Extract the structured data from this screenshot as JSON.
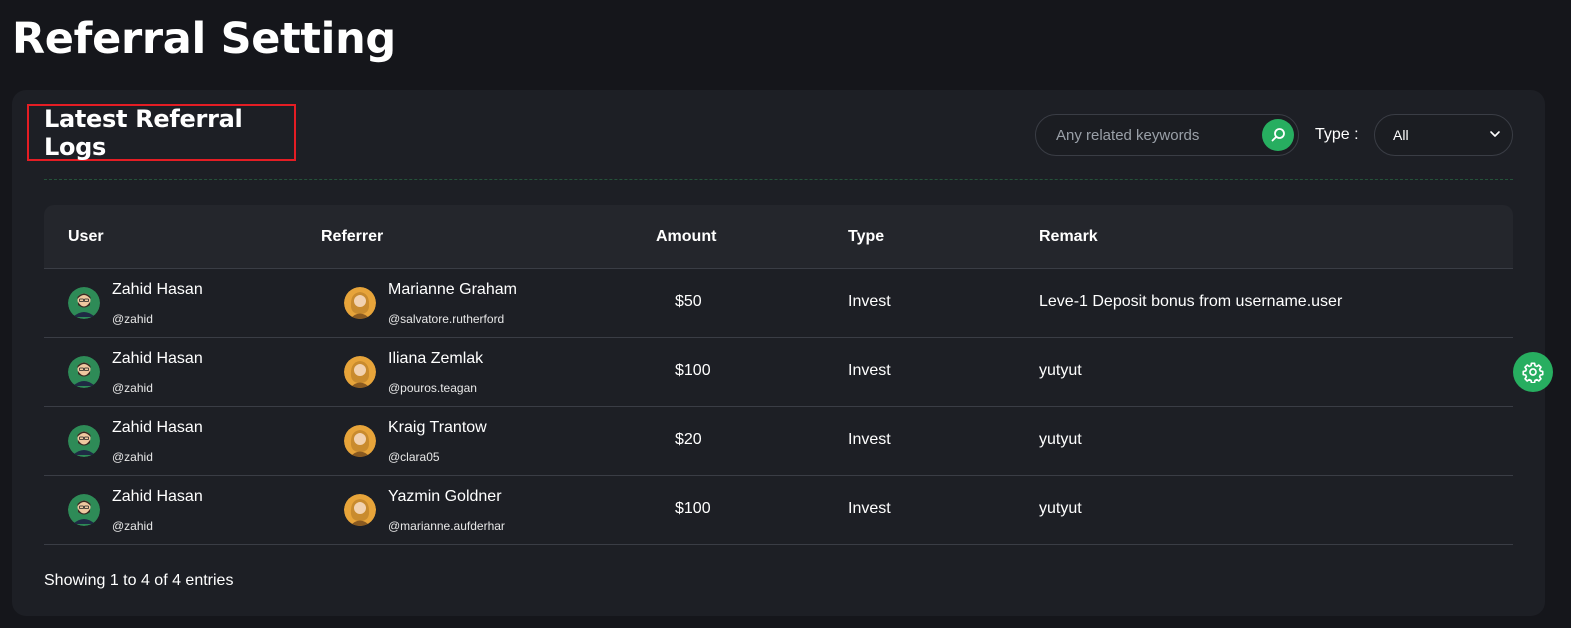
{
  "page": {
    "title": "Referral Setting"
  },
  "card": {
    "title": "Latest Referral Logs",
    "search": {
      "placeholder": "Any related keywords",
      "value": ""
    },
    "type_filter": {
      "label": "Type :",
      "selected": "All"
    }
  },
  "table": {
    "columns": [
      "User",
      "Referrer",
      "Amount",
      "Type",
      "Remark"
    ],
    "rows": [
      {
        "user_name": "Zahid Hasan",
        "user_handle": "@zahid",
        "referrer_name": "Marianne Graham",
        "referrer_handle": "@salvatore.rutherford",
        "amount": "$50",
        "type": "Invest",
        "remark": "Leve-1 Deposit bonus from username.user"
      },
      {
        "user_name": "Zahid Hasan",
        "user_handle": "@zahid",
        "referrer_name": "Iliana Zemlak",
        "referrer_handle": "@pouros.teagan",
        "amount": "$100",
        "type": "Invest",
        "remark": "yutyut"
      },
      {
        "user_name": "Zahid Hasan",
        "user_handle": "@zahid",
        "referrer_name": "Kraig Trantow",
        "referrer_handle": "@clara05",
        "amount": "$20",
        "type": "Invest",
        "remark": "yutyut"
      },
      {
        "user_name": "Zahid Hasan",
        "user_handle": "@zahid",
        "referrer_name": "Yazmin Goldner",
        "referrer_handle": "@marianne.aufderhar",
        "amount": "$100",
        "type": "Invest",
        "remark": "yutyut"
      }
    ]
  },
  "footer": {
    "entries_text": "Showing 1 to 4 of 4 entries"
  },
  "colors": {
    "accent": "#27ae60",
    "highlight_border": "#e41d24",
    "background": "#15161b",
    "card": "#1d1f25"
  },
  "icons": {
    "search": "search-icon",
    "chevron": "chevron-down-icon",
    "settings": "gear-icon",
    "user_avatar": "avatar",
    "referrer_avatar": "avatar"
  }
}
